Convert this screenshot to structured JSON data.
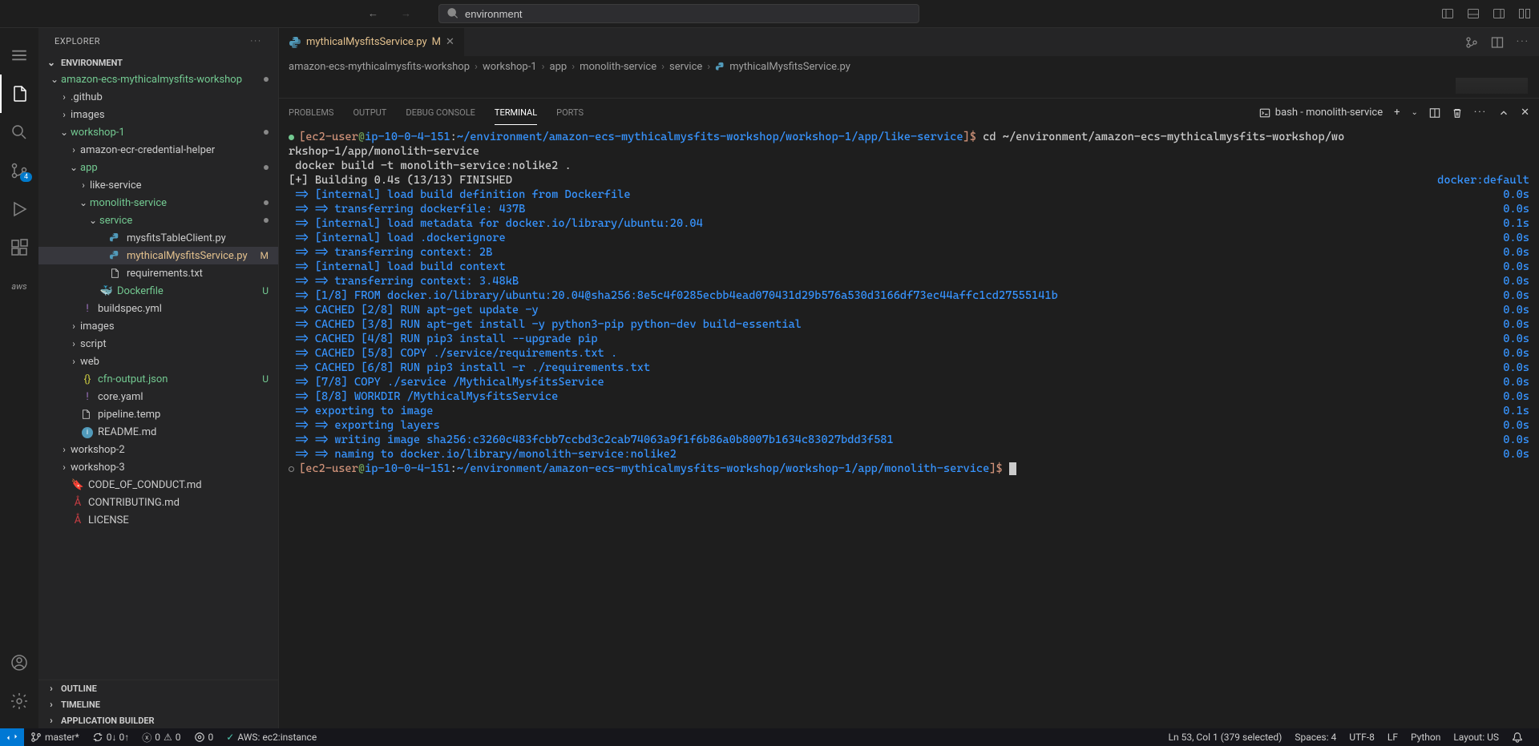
{
  "titlebar": {
    "search_value": "environment"
  },
  "sidebar": {
    "title": "EXPLORER",
    "section": "ENVIRONMENT",
    "tree": [
      {
        "indent": 1,
        "chevron": "down",
        "label": "amazon-ecs-mythicalmysfits-workshop",
        "class": "folder-green",
        "dot": true
      },
      {
        "indent": 2,
        "chevron": "right",
        "label": ".github"
      },
      {
        "indent": 2,
        "chevron": "right",
        "label": "images"
      },
      {
        "indent": 2,
        "chevron": "down",
        "label": "workshop-1",
        "class": "folder-green",
        "dot": true
      },
      {
        "indent": 3,
        "chevron": "right",
        "label": "amazon-ecr-credential-helper"
      },
      {
        "indent": 3,
        "chevron": "down",
        "label": "app",
        "class": "folder-green",
        "dot": true
      },
      {
        "indent": 4,
        "chevron": "right",
        "label": "like-service"
      },
      {
        "indent": 4,
        "chevron": "down",
        "label": "monolith-service",
        "class": "folder-green",
        "dot": true
      },
      {
        "indent": 5,
        "chevron": "down",
        "label": "service",
        "class": "folder-green",
        "dot": true
      },
      {
        "indent": 6,
        "icon": "python",
        "label": "mysfitsTableClient.py"
      },
      {
        "indent": 6,
        "icon": "python",
        "label": "mythicalMysfitsService.py",
        "class": "file-modified",
        "badge": "M",
        "selected": true
      },
      {
        "indent": 6,
        "icon": "txt",
        "label": "requirements.txt"
      },
      {
        "indent": 5,
        "icon": "docker",
        "label": "Dockerfile",
        "class": "file-untracked",
        "badge": "U"
      },
      {
        "indent": 3,
        "icon": "yaml",
        "label": "buildspec.yml"
      },
      {
        "indent": 3,
        "chevron": "right",
        "label": "images"
      },
      {
        "indent": 3,
        "chevron": "right",
        "label": "script"
      },
      {
        "indent": 3,
        "chevron": "right",
        "label": "web"
      },
      {
        "indent": 3,
        "icon": "json",
        "label": "cfn-output.json",
        "class": "file-untracked",
        "badge": "U"
      },
      {
        "indent": 3,
        "icon": "yaml",
        "label": "core.yaml"
      },
      {
        "indent": 3,
        "icon": "txt",
        "label": "pipeline.temp"
      },
      {
        "indent": 3,
        "icon": "readme",
        "label": "README.md"
      },
      {
        "indent": 2,
        "chevron": "right",
        "label": "workshop-2"
      },
      {
        "indent": 2,
        "chevron": "right",
        "label": "workshop-3"
      },
      {
        "indent": 2,
        "icon": "md",
        "label": "CODE_OF_CONDUCT.md"
      },
      {
        "indent": 2,
        "icon": "red",
        "label": "CONTRIBUTING.md"
      },
      {
        "indent": 2,
        "icon": "red",
        "label": "LICENSE"
      }
    ],
    "bottom_sections": [
      "OUTLINE",
      "TIMELINE",
      "APPLICATION BUILDER"
    ]
  },
  "editor": {
    "tab": {
      "icon": "python",
      "label": "mythicalMysfitsService.py",
      "badge": "M"
    },
    "breadcrumbs": [
      "amazon-ecs-mythicalmysfits-workshop",
      "workshop-1",
      "app",
      "monolith-service",
      "service",
      "mythicalMysfitsService.py"
    ]
  },
  "panel": {
    "tabs": [
      "PROBLEMS",
      "OUTPUT",
      "DEBUG CONSOLE",
      "TERMINAL",
      "PORTS"
    ],
    "active_tab": "TERMINAL",
    "terminal_name": "bash - monolith-service"
  },
  "terminal": {
    "lines": [
      {
        "bullet": "green",
        "prompt": {
          "user": "ec2-user",
          "at": "@",
          "host": "ip-10-0-4-151",
          "sep": ":",
          "path": "~/environment/amazon-ecs-mythicalmysfits-workshop/workshop-1/app/like-service",
          "end": "]$"
        },
        "cmd": " cd ~/environment/amazon-ecs-mythicalmysfits-workshop/wo"
      },
      {
        "text": "rkshop-1/app/monolith-service"
      },
      {
        "text": " docker build -t monolith-service:nolike2 ."
      },
      {
        "text": "[+] Building 0.4s (13/13) FINISHED",
        "right": "docker:default"
      },
      {
        "blue": " => [internal] load build definition from Dockerfile",
        "right": "0.0s"
      },
      {
        "blue": " => => transferring dockerfile: 437B",
        "right": "0.0s"
      },
      {
        "blue": " => [internal] load metadata for docker.io/library/ubuntu:20.04",
        "right": "0.1s"
      },
      {
        "blue": " => [internal] load .dockerignore",
        "right": "0.0s"
      },
      {
        "blue": " => => transferring context: 2B",
        "right": "0.0s"
      },
      {
        "blue": " => [internal] load build context",
        "right": "0.0s"
      },
      {
        "blue": " => => transferring context: 3.48kB",
        "right": "0.0s"
      },
      {
        "blue": " => [1/8] FROM docker.io/library/ubuntu:20.04@sha256:8e5c4f0285ecbb4ead070431d29b576a530d3166df73ec44affc1cd27555141b",
        "right": "0.0s"
      },
      {
        "blue": " => CACHED [2/8] RUN apt-get update -y",
        "right": "0.0s"
      },
      {
        "blue": " => CACHED [3/8] RUN apt-get install -y python3-pip python-dev build-essential",
        "right": "0.0s"
      },
      {
        "blue": " => CACHED [4/8] RUN pip3 install --upgrade pip",
        "right": "0.0s"
      },
      {
        "blue": " => CACHED [5/8] COPY ./service/requirements.txt .",
        "right": "0.0s"
      },
      {
        "blue": " => CACHED [6/8] RUN pip3 install -r ./requirements.txt",
        "right": "0.0s"
      },
      {
        "blue": " => [7/8] COPY ./service /MythicalMysfitsService",
        "right": "0.0s"
      },
      {
        "blue": " => [8/8] WORKDIR /MythicalMysfitsService",
        "right": "0.0s"
      },
      {
        "blue": " => exporting to image",
        "right": "0.1s"
      },
      {
        "blue": " => => exporting layers",
        "right": "0.0s"
      },
      {
        "blue": " => => writing image sha256:c3260c483fcbb7ccbd3c2cab74063a9f1f6b86a0b8007b1634c83027bdd3f581",
        "right": "0.0s"
      },
      {
        "blue": " => => naming to docker.io/library/monolith-service:nolike2",
        "right": "0.0s"
      },
      {
        "bullet": "hollow",
        "prompt": {
          "user": "ec2-user",
          "at": "@",
          "host": "ip-10-0-4-151",
          "sep": ":",
          "path": "~/environment/amazon-ecs-mythicalmysfits-workshop/workshop-1/app/monolith-service",
          "end": "]$"
        },
        "cursor": true
      }
    ]
  },
  "statusbar": {
    "branch": "master*",
    "sync": "0↓ 0↑",
    "errors": "0",
    "warnings": "0",
    "ports": "0",
    "aws": "AWS: ec2:instance",
    "position": "Ln 53, Col 1 (379 selected)",
    "spaces": "Spaces: 4",
    "encoding": "UTF-8",
    "eol": "LF",
    "language": "Python",
    "layout": "Layout: US"
  },
  "activity": {
    "scm_badge": "4",
    "aws_label": "aws"
  }
}
